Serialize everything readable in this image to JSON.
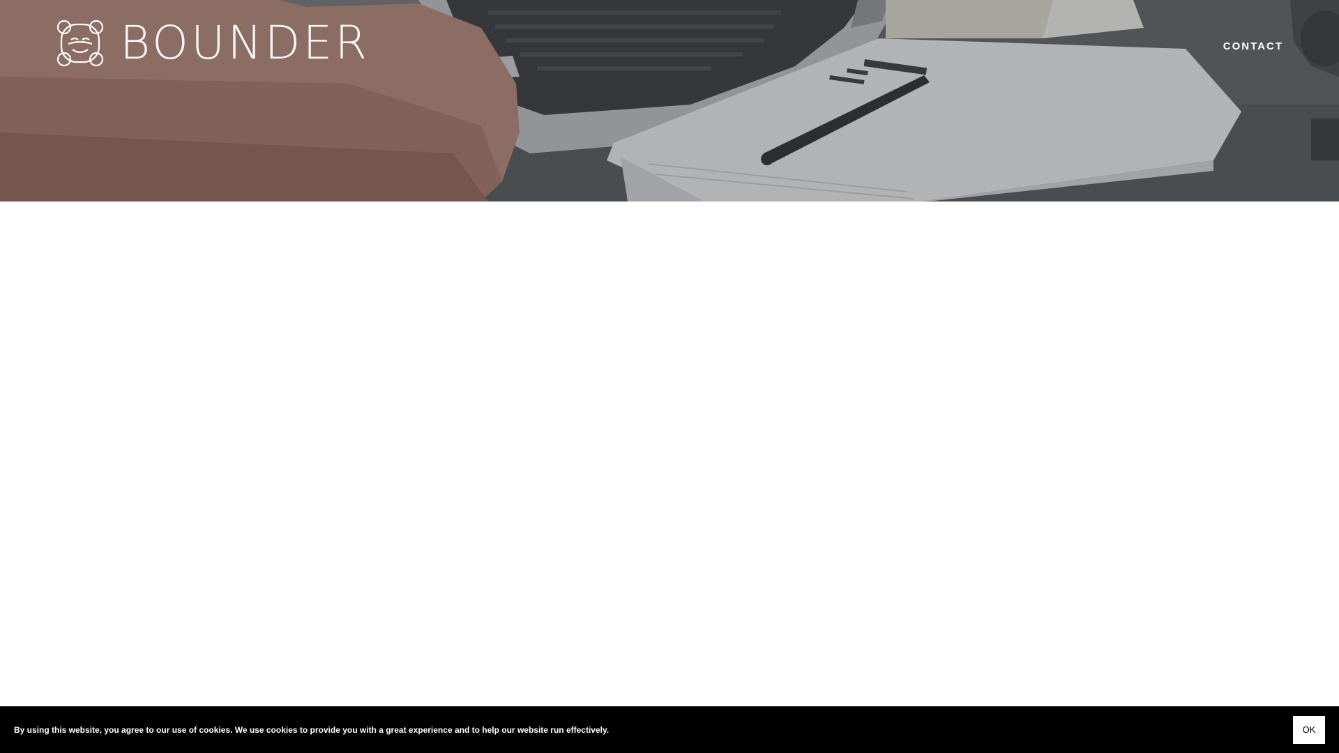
{
  "header": {
    "logo_text": "BOUNDER",
    "nav": [
      {
        "label": "CONTACT"
      }
    ]
  },
  "hero": {
    "image_description_icon": "desk-photo-icon",
    "overlay_color": "#4a4c50"
  },
  "cookie_banner": {
    "message": "By using this website, you agree to our use of cookies. We use cookies to provide you with a great experience and to help our website run effectively.",
    "ok_label": "OK"
  },
  "colors": {
    "cookie_bg": "#000000",
    "text_light": "#ffffff",
    "page_bg": "#ffffff"
  }
}
